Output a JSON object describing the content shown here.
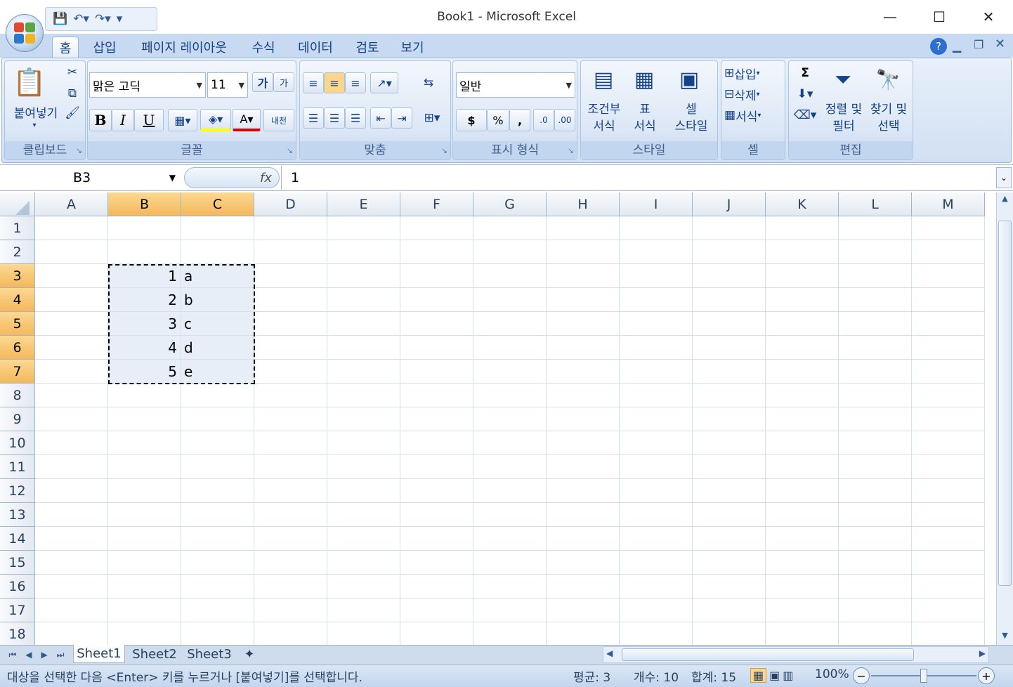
{
  "window": {
    "title": "Book1 - Microsoft Excel",
    "minimize": "—",
    "maximize": "☐",
    "close": "✕"
  },
  "ribbon_tabs": [
    "홈",
    "삽입",
    "페이지 레이아웃",
    "수식",
    "데이터",
    "검토",
    "보기"
  ],
  "groups": {
    "clipboard": {
      "label": "클립보드",
      "paste": "붙여넣기"
    },
    "font": {
      "label": "글꼴",
      "font_name": "맑은 고딕",
      "font_size": "11",
      "bold": "B",
      "italic": "I",
      "underline": "U",
      "grow": "가",
      "shrink": "가",
      "phonetic": "내천"
    },
    "alignment": {
      "label": "맞춤"
    },
    "number": {
      "label": "표시 형식",
      "format": "일반",
      "currency": "$",
      "percent": "%",
      "comma": ","
    },
    "styles": {
      "label": "스타일",
      "conditional": [
        "조건부",
        "서식"
      ],
      "table": [
        "표",
        "서식"
      ],
      "cell": [
        "셀",
        "스타일"
      ]
    },
    "cells": {
      "label": "셀",
      "insert": "삽입",
      "delete": "삭제",
      "format": "서식"
    },
    "editing": {
      "label": "편집",
      "sort": [
        "정렬 및",
        "필터"
      ],
      "find": [
        "찾기 및",
        "선택"
      ],
      "sum": "Σ"
    }
  },
  "formula_bar": {
    "name_box": "B3",
    "fx": "fx",
    "value": "1"
  },
  "columns": [
    "A",
    "B",
    "C",
    "D",
    "E",
    "F",
    "G",
    "H",
    "I",
    "J",
    "K",
    "L",
    "M"
  ],
  "rows": [
    "1",
    "2",
    "3",
    "4",
    "5",
    "6",
    "7",
    "8",
    "9",
    "10",
    "11",
    "12",
    "13",
    "14",
    "15",
    "16",
    "17",
    "18"
  ],
  "cells": {
    "B3": "1",
    "C3": "a",
    "B4": "2",
    "C4": "b",
    "B5": "3",
    "C5": "c",
    "B6": "4",
    "C6": "d",
    "B7": "5",
    "C7": "e"
  },
  "sheets": [
    "Sheet1",
    "Sheet2",
    "Sheet3"
  ],
  "status": {
    "message": "대상을 선택한 다음 <Enter> 키를 누르거나 [붙여넣기]를 선택합니다.",
    "average": "평균: 3",
    "count": "개수: 10",
    "sum": "합계: 15",
    "zoom": "100%"
  }
}
